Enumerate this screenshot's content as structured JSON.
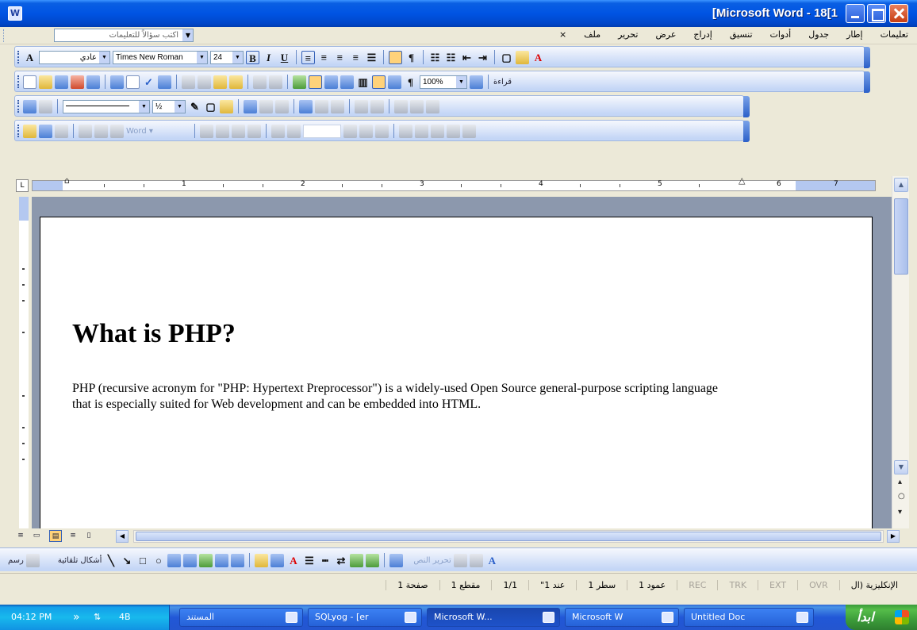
{
  "window": {
    "title": "[Microsoft Word - 18[1"
  },
  "menubar": {
    "help_placeholder": "اكتب سؤالاً للتعليمات",
    "items": [
      "ملف",
      "تحرير",
      "عرض",
      "إدراج",
      "تنسيق",
      "أدوات",
      "جدول",
      "إطار",
      "تعليمات"
    ],
    "close_label": "×"
  },
  "format_toolbar": {
    "style": "عادي",
    "font": "Times New Roman",
    "size": "24",
    "bold": "B",
    "italic": "I",
    "underline": "U"
  },
  "standard_toolbar": {
    "zoom": "100%",
    "reading_label": "قراءة",
    "pilcrow": "¶"
  },
  "tables_toolbar": {
    "line_weight": "½"
  },
  "ruler": {
    "numbers": [
      "1",
      "2",
      "3",
      "4",
      "5",
      "6",
      "7"
    ]
  },
  "document": {
    "heading": "What is PHP?",
    "paragraph": "PHP (recursive acronym for \"PHP: Hypertext Preprocessor\") is a widely-used Open Source general-purpose scripting language that is especially suited for Web development and can be embedded into HTML."
  },
  "drawing_toolbar": {
    "draw_label": "رسم",
    "autoshapes_label": "أشكال تلقائية",
    "edit_label": "تحرير النص"
  },
  "statusbar": {
    "page": "صفحة 1",
    "section": "مقطع 1",
    "pages": "1/1",
    "at": "عند 1\"",
    "line": "سطر 1",
    "col": "عمود 1",
    "rec": "REC",
    "trk": "TRK",
    "ext": "EXT",
    "ovr": "OVR",
    "language": "الإنكليزية (ال"
  },
  "taskbar": {
    "start_label": "ابدأ",
    "clock": "04:12 PM",
    "tray_text": "4B",
    "tasks": [
      "Untitled Doc",
      "Microsoft W",
      "Microsoft W...",
      "SQLyog - [er",
      "المستند"
    ]
  }
}
